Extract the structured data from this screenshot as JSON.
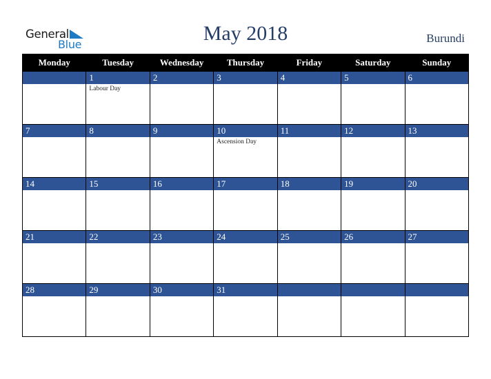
{
  "logo": {
    "word1": "General",
    "word2": "Blue",
    "icon": "triangle-flag-icon"
  },
  "header": {
    "title": "May 2018",
    "country": "Burundi"
  },
  "colors": {
    "band": "#2e5496",
    "header_bg": "#000000",
    "title": "#253e66",
    "logo_blue": "#1e7ac2"
  },
  "weekdays": [
    "Monday",
    "Tuesday",
    "Wednesday",
    "Thursday",
    "Friday",
    "Saturday",
    "Sunday"
  ],
  "weeks": [
    [
      {
        "day": "",
        "event": ""
      },
      {
        "day": "1",
        "event": "Labour Day"
      },
      {
        "day": "2",
        "event": ""
      },
      {
        "day": "3",
        "event": ""
      },
      {
        "day": "4",
        "event": ""
      },
      {
        "day": "5",
        "event": ""
      },
      {
        "day": "6",
        "event": ""
      }
    ],
    [
      {
        "day": "7",
        "event": ""
      },
      {
        "day": "8",
        "event": ""
      },
      {
        "day": "9",
        "event": ""
      },
      {
        "day": "10",
        "event": "Ascension Day"
      },
      {
        "day": "11",
        "event": ""
      },
      {
        "day": "12",
        "event": ""
      },
      {
        "day": "13",
        "event": ""
      }
    ],
    [
      {
        "day": "14",
        "event": ""
      },
      {
        "day": "15",
        "event": ""
      },
      {
        "day": "16",
        "event": ""
      },
      {
        "day": "17",
        "event": ""
      },
      {
        "day": "18",
        "event": ""
      },
      {
        "day": "19",
        "event": ""
      },
      {
        "day": "20",
        "event": ""
      }
    ],
    [
      {
        "day": "21",
        "event": ""
      },
      {
        "day": "22",
        "event": ""
      },
      {
        "day": "23",
        "event": ""
      },
      {
        "day": "24",
        "event": ""
      },
      {
        "day": "25",
        "event": ""
      },
      {
        "day": "26",
        "event": ""
      },
      {
        "day": "27",
        "event": ""
      }
    ],
    [
      {
        "day": "28",
        "event": ""
      },
      {
        "day": "29",
        "event": ""
      },
      {
        "day": "30",
        "event": ""
      },
      {
        "day": "31",
        "event": ""
      },
      {
        "day": "",
        "event": ""
      },
      {
        "day": "",
        "event": ""
      },
      {
        "day": "",
        "event": ""
      }
    ]
  ]
}
